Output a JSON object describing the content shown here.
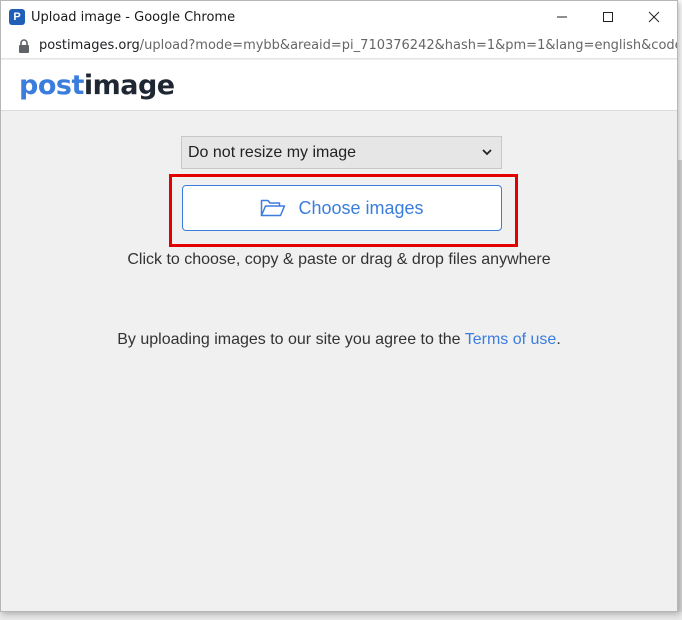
{
  "window": {
    "app_icon_letter": "P",
    "title": "Upload image - Google Chrome",
    "url_domain": "postimages.org",
    "url_path": "/upload?mode=mybb&areaid=pi_710376242&hash=1&pm=1&lang=english&code..."
  },
  "site": {
    "logo_post": "post",
    "logo_image": "image"
  },
  "upload": {
    "resize_selected": "Do not resize my image",
    "choose_label": "Choose images",
    "hint": "Click to choose, copy & paste or drag & drop files anywhere",
    "terms_prefix": "By uploading images to our site you agree to the ",
    "terms_link": "Terms of use",
    "terms_suffix": "."
  },
  "colors": {
    "brand_blue": "#3b7ddd",
    "highlight_red": "#e30000"
  }
}
